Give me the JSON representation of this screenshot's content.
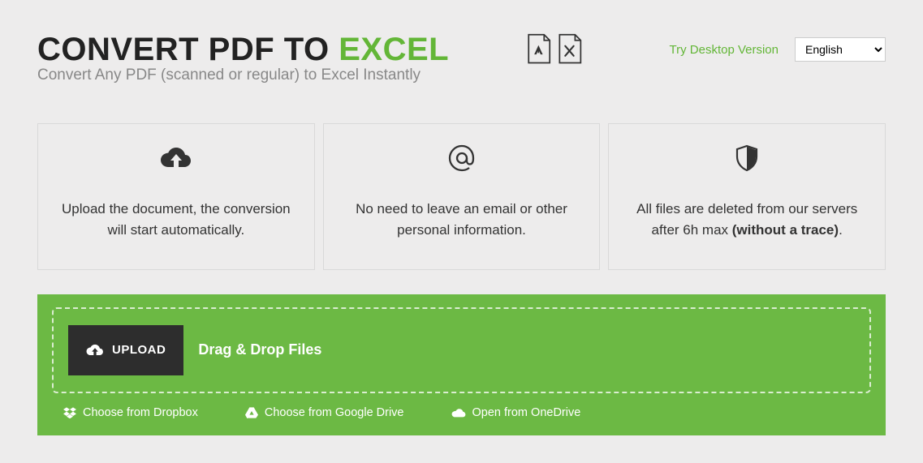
{
  "header": {
    "title_prefix": "CONVERT PDF TO ",
    "title_accent": "EXCEL",
    "subtitle": "Convert Any PDF (scanned or regular) to Excel Instantly",
    "try_desktop": "Try Desktop Version",
    "language_selected": "English"
  },
  "features": [
    {
      "text": "Upload the document, the conversion will start automatically."
    },
    {
      "text": "No need to leave an email or other personal information."
    },
    {
      "text_prefix": "All files are deleted from our servers after 6h max ",
      "text_bold": "(without a trace)",
      "text_suffix": "."
    }
  ],
  "upload": {
    "button_label": "UPLOAD",
    "drag_label": "Drag & Drop Files",
    "cloud": {
      "dropbox": "Choose from Dropbox",
      "gdrive": "Choose from Google Drive",
      "onedrive": "Open from OneDrive"
    }
  }
}
